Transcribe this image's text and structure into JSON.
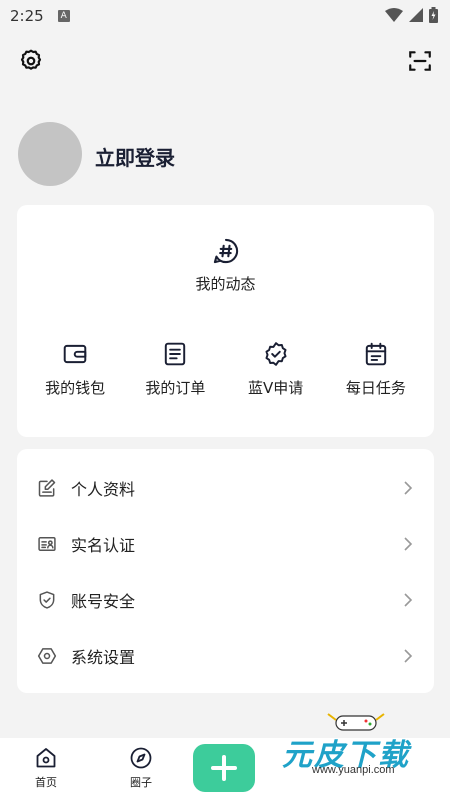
{
  "status_bar": {
    "time": "2:25",
    "notification_letter": "A"
  },
  "profile": {
    "login_label": "立即登录"
  },
  "top_card": {
    "dynamic_label": "我的动态",
    "quick_items": [
      {
        "label": "我的钱包",
        "icon": "wallet-icon"
      },
      {
        "label": "我的订单",
        "icon": "order-icon"
      },
      {
        "label": "蓝V申请",
        "icon": "verified-badge-icon"
      },
      {
        "label": "每日任务",
        "icon": "calendar-icon"
      }
    ]
  },
  "menu": {
    "items": [
      {
        "label": "个人资料",
        "icon": "edit-profile-icon"
      },
      {
        "label": "实名认证",
        "icon": "id-card-icon"
      },
      {
        "label": "账号安全",
        "icon": "shield-icon"
      },
      {
        "label": "系统设置",
        "icon": "hex-settings-icon"
      }
    ]
  },
  "watermark": {
    "text": "元皮下载",
    "url": "www.yuanpi.com"
  },
  "bottom_nav": {
    "home_label": "首页",
    "circle_label": "圈子"
  },
  "colors": {
    "accent": "#3dcc9b",
    "title": "#1a1f33"
  }
}
